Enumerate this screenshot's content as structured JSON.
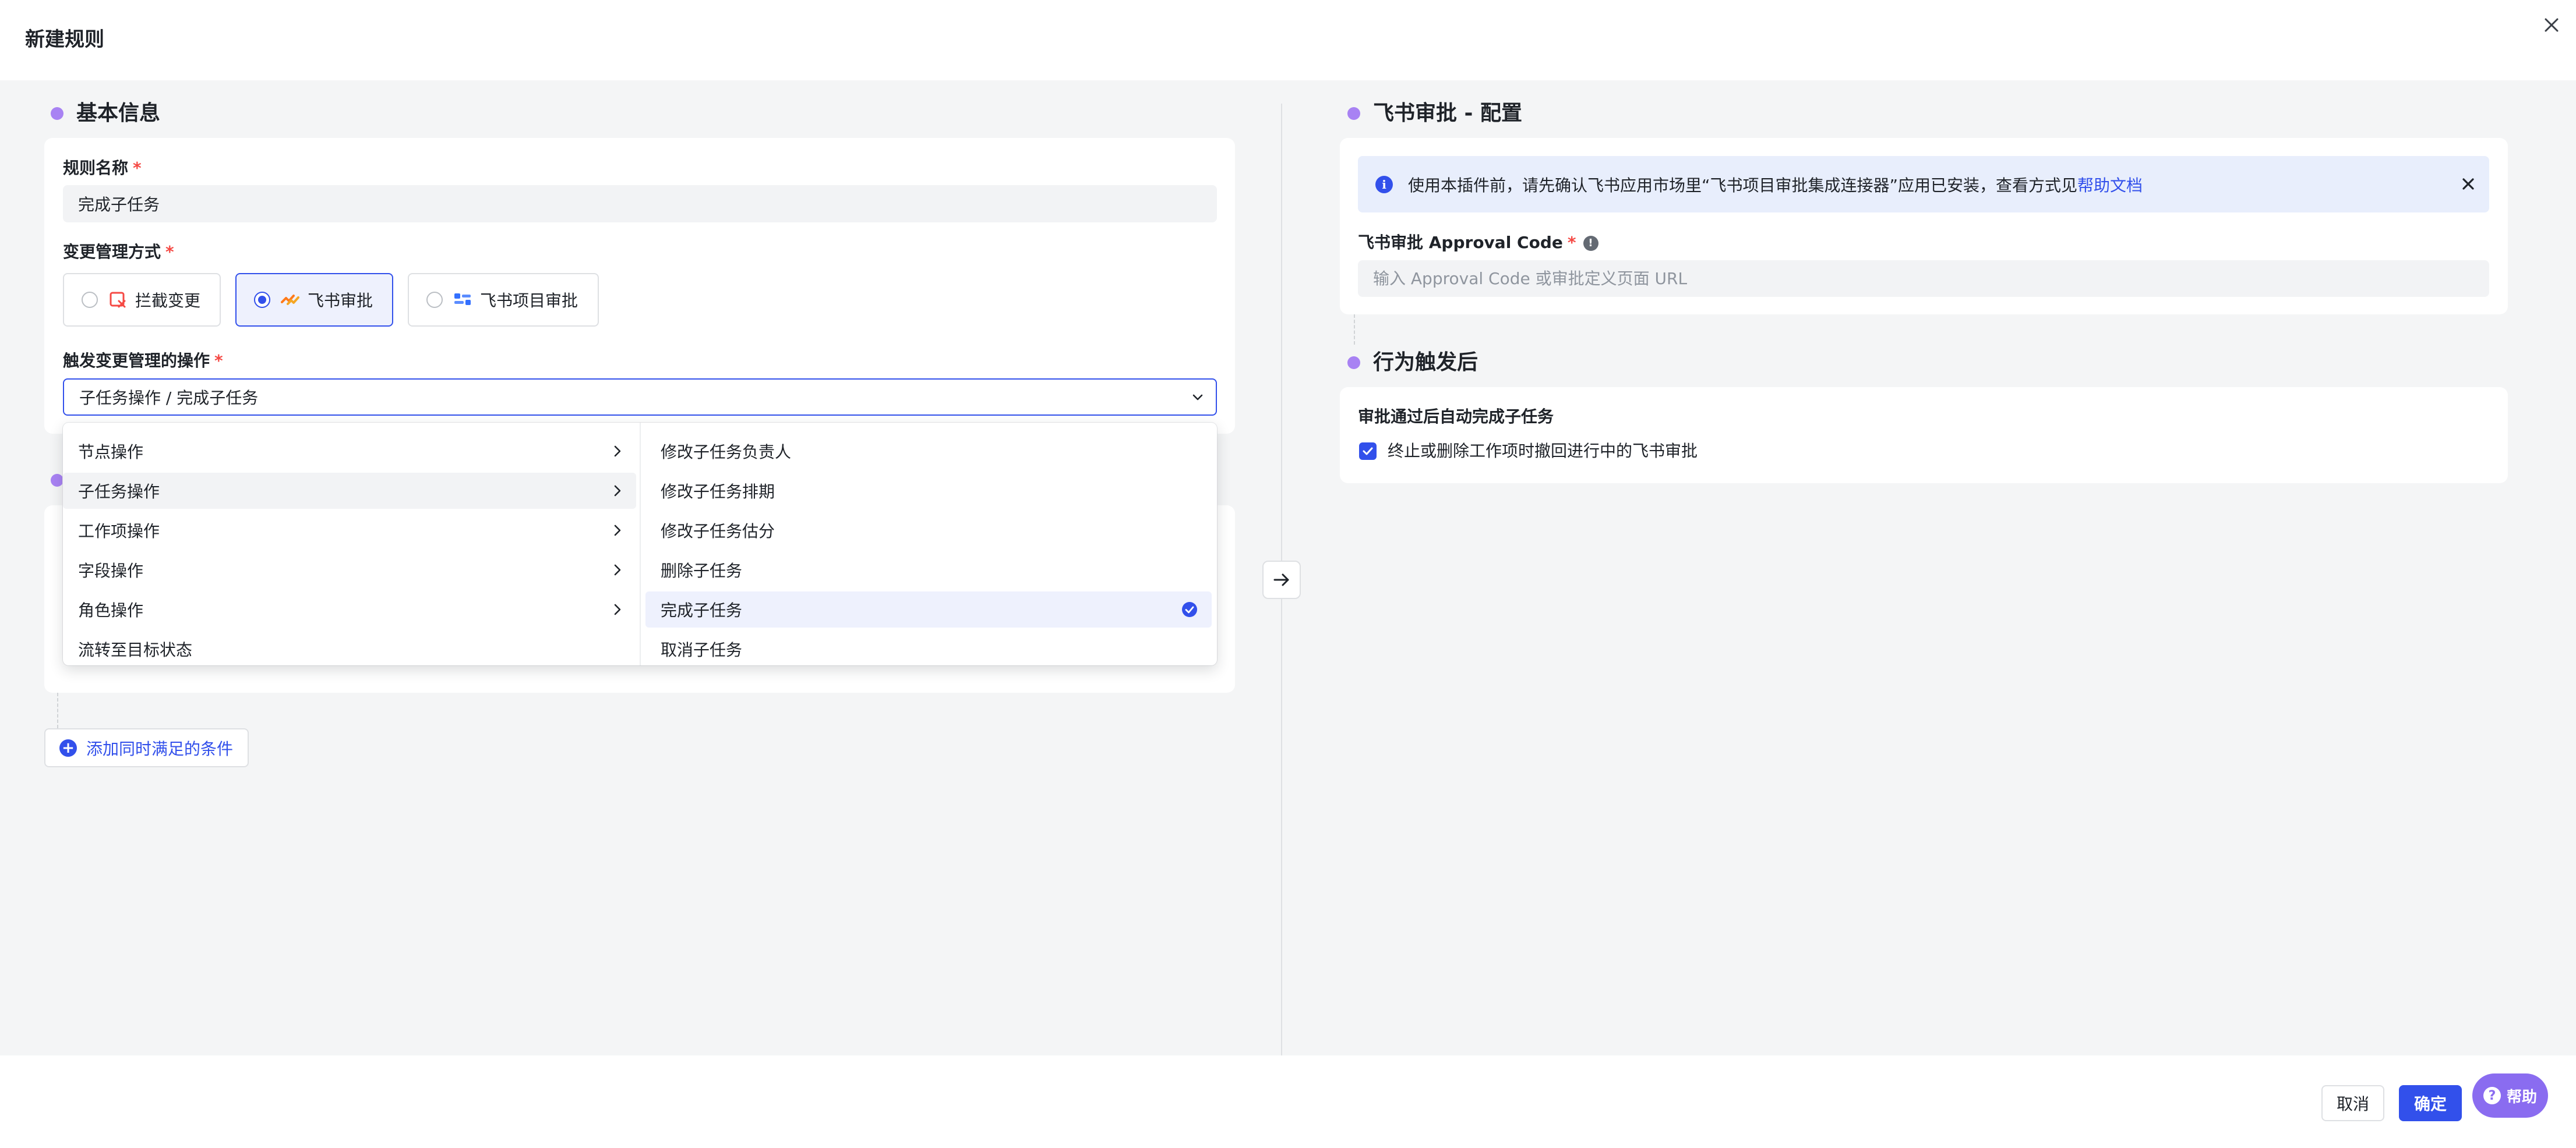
{
  "dialog": {
    "title": "新建规则"
  },
  "basic_info": {
    "section_title": "基本信息",
    "rule_name": {
      "label": "规则名称",
      "required_mark": "*",
      "value": "完成子任务"
    },
    "change_mode": {
      "label": "变更管理方式",
      "required_mark": "*",
      "options": [
        {
          "label": "拦截变更",
          "icon": "block-change-icon",
          "selected": false
        },
        {
          "label": "飞书审批",
          "icon": "feishu-approval-icon",
          "selected": true
        },
        {
          "label": "飞书项目审批",
          "icon": "feishu-project-approval-icon",
          "selected": false
        }
      ]
    },
    "trigger": {
      "label": "触发变更管理的操作",
      "required_mark": "*",
      "value": "子任务操作 / 完成子任务"
    }
  },
  "dropdown": {
    "categories": [
      {
        "label": "节点操作",
        "has_children": true
      },
      {
        "label": "子任务操作",
        "has_children": true,
        "active": true
      },
      {
        "label": "工作项操作",
        "has_children": true
      },
      {
        "label": "字段操作",
        "has_children": true
      },
      {
        "label": "角色操作",
        "has_children": true
      },
      {
        "label": "流转至目标状态",
        "has_children": false
      }
    ],
    "actions": [
      {
        "label": "修改子任务负责人"
      },
      {
        "label": "修改子任务排期"
      },
      {
        "label": "修改子任务估分"
      },
      {
        "label": "删除子任务"
      },
      {
        "label": "完成子任务",
        "selected": true
      },
      {
        "label": "取消子任务"
      }
    ]
  },
  "conditions": {
    "add_button_label": "添加同时满足的条件"
  },
  "feishu_config": {
    "section_title": "飞书审批 - 配置",
    "banner": {
      "text": "使用本插件前，请先确认飞书应用市场里“飞书项目审批集成连接器”应用已安装，查看方式见",
      "link_text": "帮助文档"
    },
    "approval_code": {
      "label": "飞书审批 Approval Code",
      "required_mark": "*",
      "placeholder": "输入 Approval Code 或审批定义页面 URL",
      "value": ""
    }
  },
  "after_trigger": {
    "section_title": "行为触发后",
    "label": "审批通过后自动完成子任务",
    "checkbox_label": "终止或删除工作项时撤回进行中的飞书审批",
    "checked": true
  },
  "footer": {
    "cancel_label": "取消",
    "ok_label": "确定",
    "help_label": "帮助"
  },
  "colors": {
    "primary": "#3250eb",
    "section_dot": "#a882f3",
    "required": "#f54a45",
    "help_button": "#8a6cf0"
  }
}
